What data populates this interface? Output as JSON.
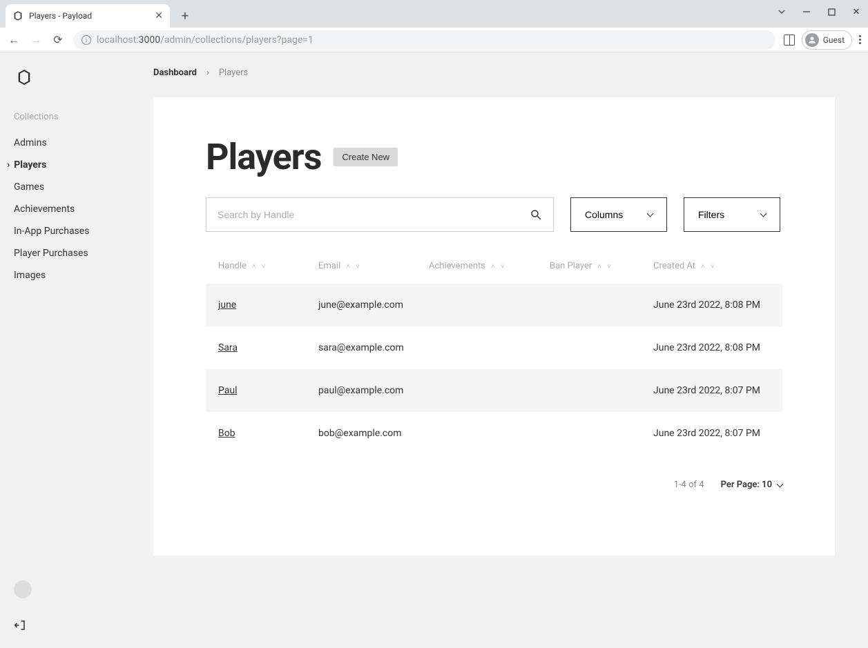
{
  "browser": {
    "tab_title": "Players - Payload",
    "url_host_dim": "localhost:",
    "url_port": "3000",
    "url_path": "/admin/collections/players?page=1",
    "guest_label": "Guest"
  },
  "sidebar": {
    "heading": "Collections",
    "items": [
      {
        "label": "Admins"
      },
      {
        "label": "Players"
      },
      {
        "label": "Games"
      },
      {
        "label": "Achievements"
      },
      {
        "label": "In-App Purchases"
      },
      {
        "label": "Player Purchases"
      },
      {
        "label": "Images"
      }
    ]
  },
  "breadcrumb": {
    "root": "Dashboard",
    "current": "Players"
  },
  "page": {
    "title": "Players",
    "create_label": "Create New",
    "search_placeholder": "Search by Handle",
    "columns_label": "Columns",
    "filters_label": "Filters"
  },
  "table": {
    "headers": {
      "handle": "Handle",
      "email": "Email",
      "achievements": "Achievements",
      "ban": "Ban Player",
      "created": "Created At"
    },
    "rows": [
      {
        "handle": "june",
        "email": "june@example.com",
        "achievements": "",
        "ban": "",
        "created": "June 23rd 2022, 8:08 PM"
      },
      {
        "handle": "Sara",
        "email": "sara@example.com",
        "achievements": "",
        "ban": "",
        "created": "June 23rd 2022, 8:08 PM"
      },
      {
        "handle": "Paul",
        "email": "paul@example.com",
        "achievements": "",
        "ban": "",
        "created": "June 23rd 2022, 8:07 PM"
      },
      {
        "handle": "Bob",
        "email": "bob@example.com",
        "achievements": "",
        "ban": "",
        "created": "June 23rd 2022, 8:07 PM"
      }
    ]
  },
  "footer": {
    "range": "1-4 of 4",
    "per_page_label": "Per Page: 10"
  }
}
